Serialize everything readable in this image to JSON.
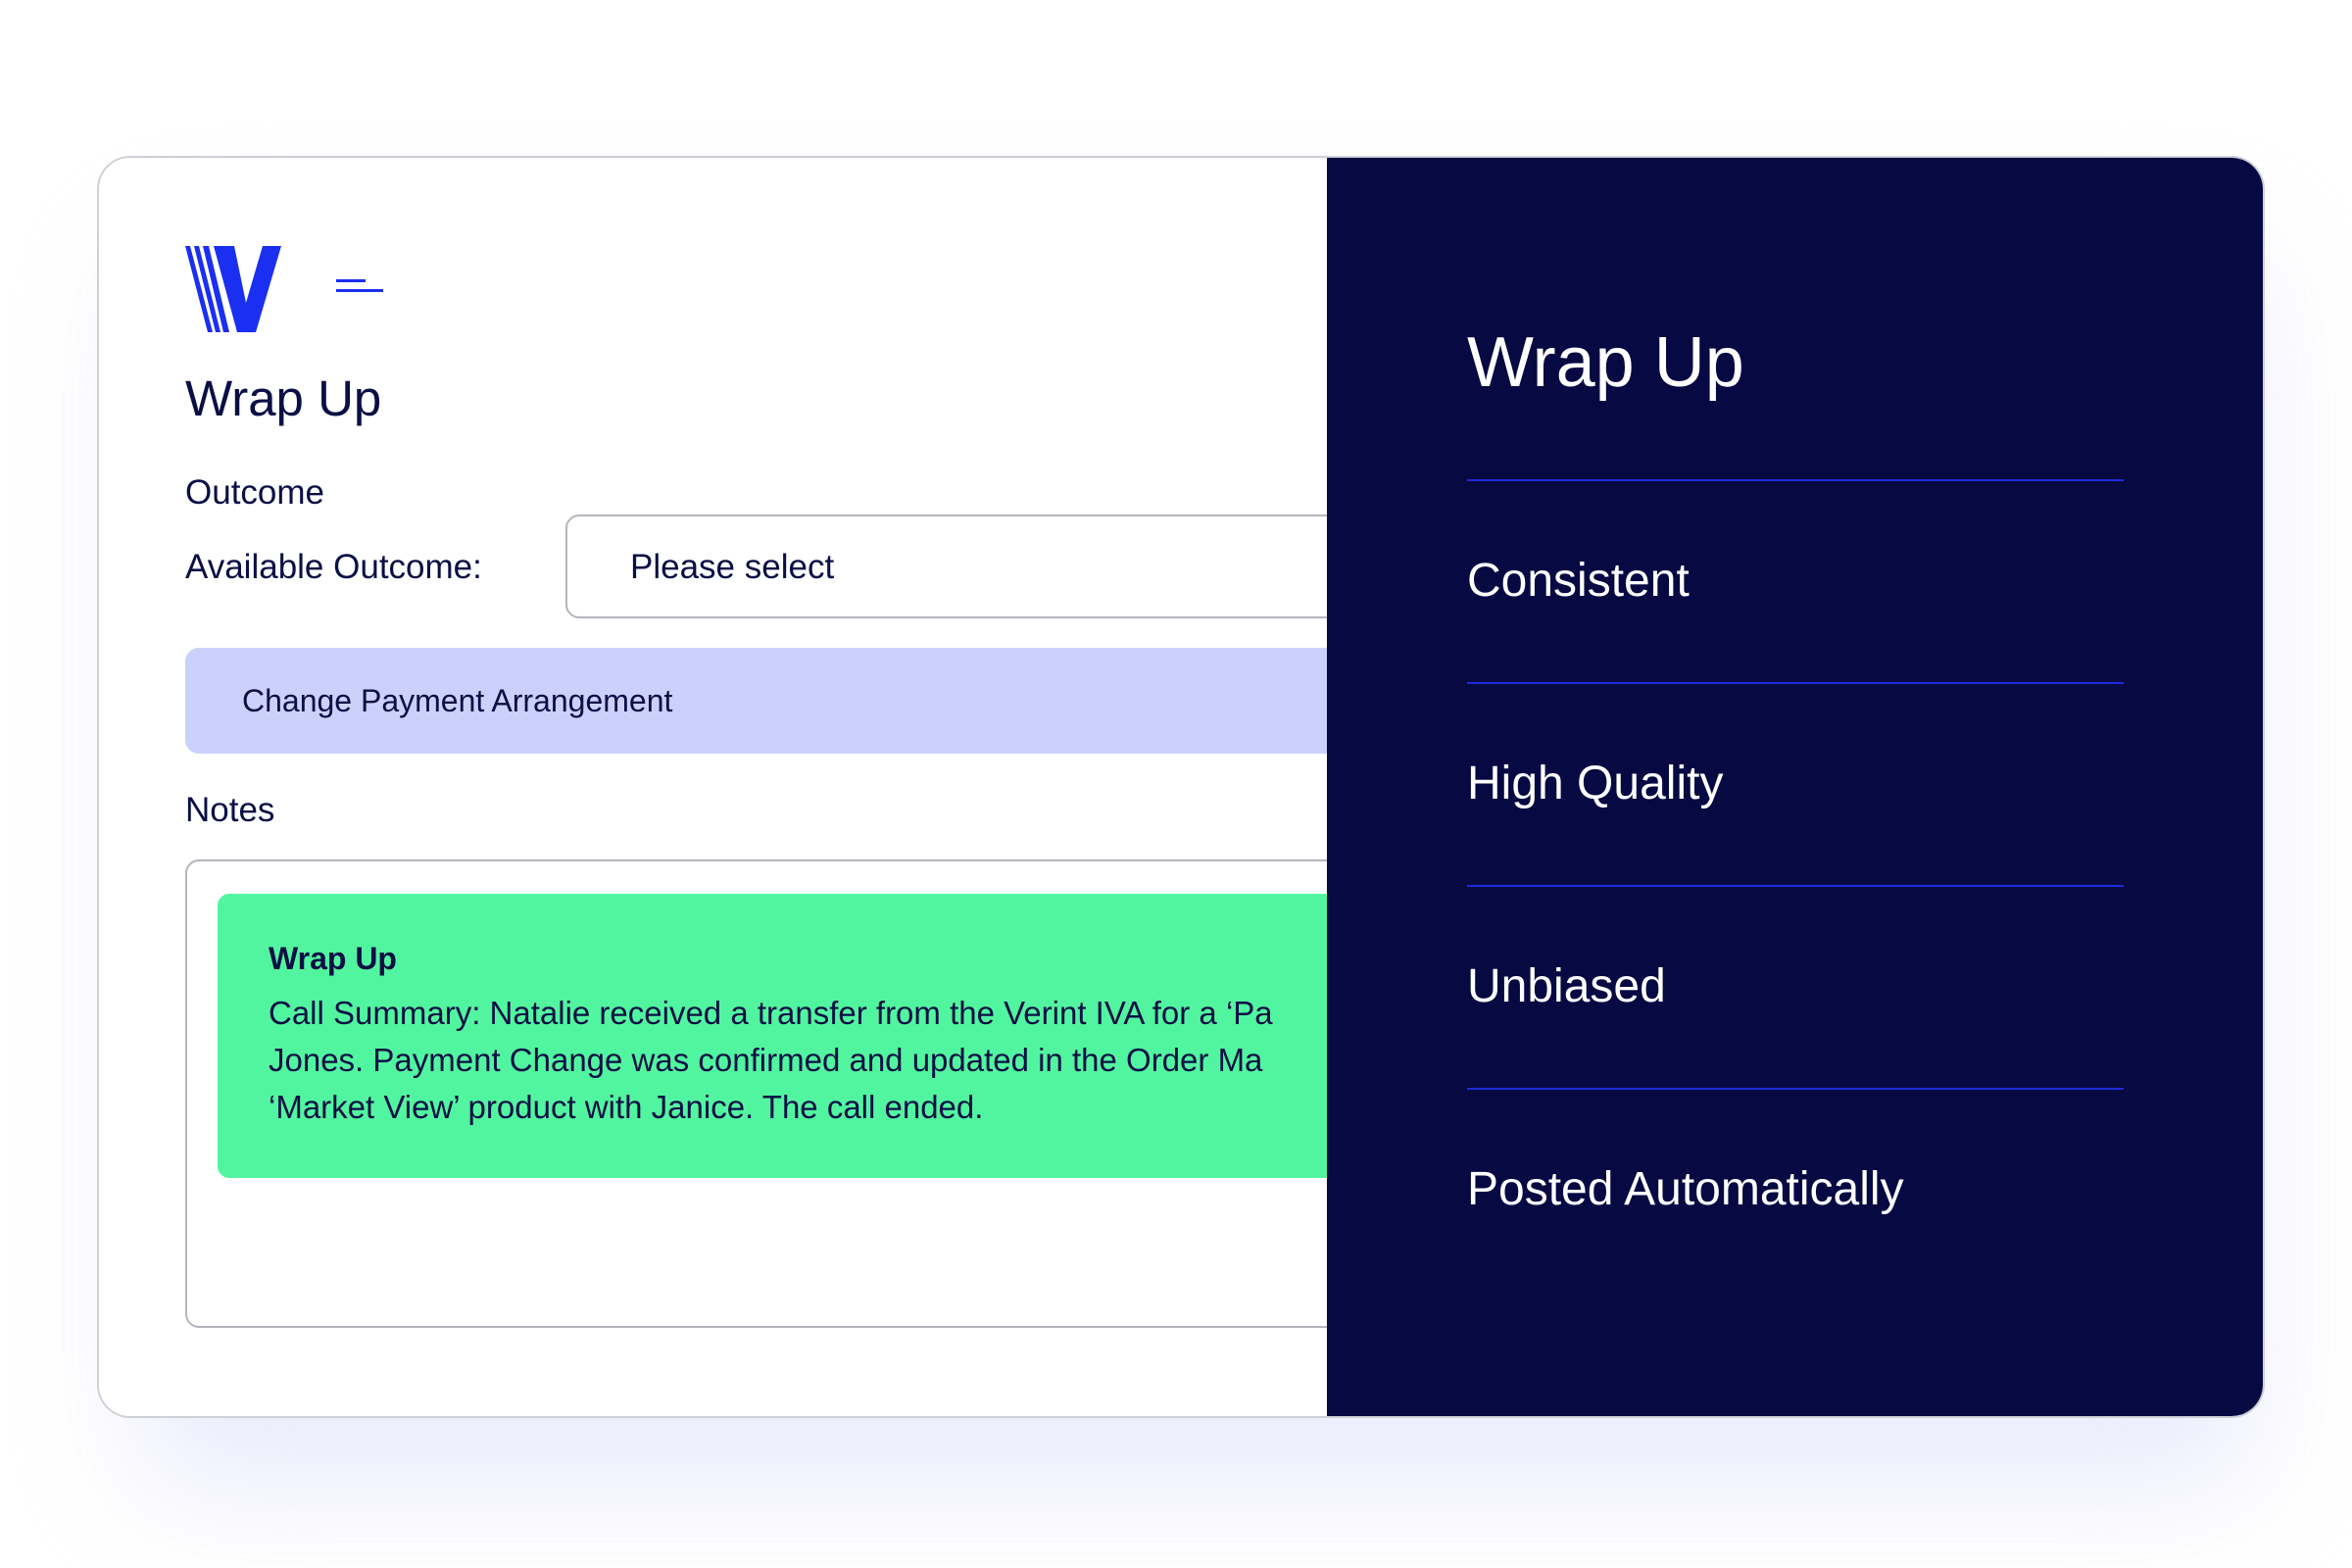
{
  "left": {
    "logo_icon": "verint-v-logo",
    "menu_icon": "hamburger-menu-icon",
    "title": "Wrap Up",
    "outcome_section": "Outcome",
    "available_outcome_label": "Available Outcome:",
    "select_value": "Please select",
    "selected_outcome": "Change Payment Arrangement",
    "notes_label": "Notes",
    "summary": {
      "title": "Wrap Up",
      "lines": [
        "Call Summary: Natalie received a transfer from the Verint IVA for a ‘Pa",
        "Jones. Payment Change was confirmed and updated in the Order Ma",
        "‘Market View’ product with Janice. The call ended."
      ]
    }
  },
  "right": {
    "title": "Wrap Up",
    "items": [
      "Consistent",
      "High Quality",
      "Unbiased",
      "Posted Automatically"
    ]
  },
  "colors": {
    "navy": "#060942",
    "brand_blue": "#1a2ff0",
    "chip_lavender": "#cad1fb",
    "summary_green": "#52f59f",
    "divider_blue": "#1d2ad9"
  }
}
